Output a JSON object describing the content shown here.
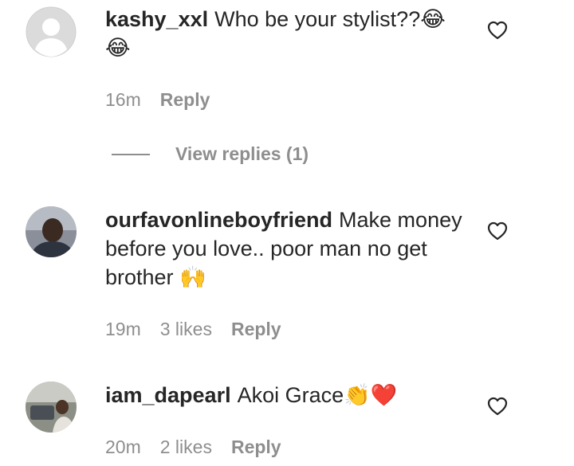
{
  "comments": [
    {
      "username": "kashy_xxl",
      "text": "Who be your stylist??😂😂",
      "time": "16m",
      "likes": "",
      "reply_label": "Reply"
    },
    {
      "username": "ourfavonlineboyfriend",
      "text": "Make money before you love.. poor man no get brother 🙌",
      "time": "19m",
      "likes": "3 likes",
      "reply_label": "Reply"
    },
    {
      "username": "iam_dapearl",
      "text": "Akoi Grace👏❤️",
      "time": "20m",
      "likes": "2 likes",
      "reply_label": "Reply"
    }
  ],
  "view_replies_label": "View replies (1)",
  "icons": {
    "like": "heart-outline-icon",
    "default_avatar": "default-avatar-icon"
  },
  "colors": {
    "text": "#262626",
    "muted": "#8e8e8e",
    "default_avatar_bg": "#dbdbdb"
  }
}
